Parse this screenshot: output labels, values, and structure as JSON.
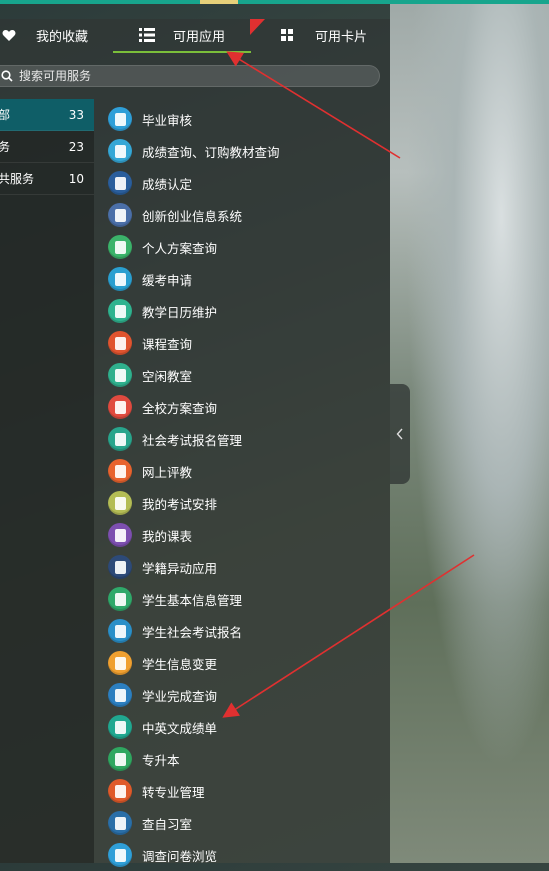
{
  "tabs": [
    {
      "label": "我的收藏",
      "icon": "heart-icon"
    },
    {
      "label": "可用应用",
      "icon": "list-icon",
      "active": true
    },
    {
      "label": "可用卡片",
      "icon": "grid-icon"
    }
  ],
  "search": {
    "placeholder": "搜索可用服务",
    "icon": "search-icon"
  },
  "categories": [
    {
      "label": "部",
      "count": "33",
      "active": true
    },
    {
      "label": "务",
      "count": "23"
    },
    {
      "label": "共服务",
      "count": "10"
    }
  ],
  "apps": [
    {
      "name": "毕业审核",
      "color": "#2f9fd8"
    },
    {
      "name": "成绩查询、订购教材查询",
      "color": "#35a7d6"
    },
    {
      "name": "成绩认定",
      "color": "#2a5e9c"
    },
    {
      "name": "创新创业信息系统",
      "color": "#4b6fa8"
    },
    {
      "name": "个人方案查询",
      "color": "#3bb36a"
    },
    {
      "name": "缓考申请",
      "color": "#2a9fd0"
    },
    {
      "name": "教学日历维护",
      "color": "#2fb38f"
    },
    {
      "name": "课程查询",
      "color": "#e0542f"
    },
    {
      "name": "空闲教室",
      "color": "#2fb08d"
    },
    {
      "name": "全校方案查询",
      "color": "#e04a3f"
    },
    {
      "name": "社会考试报名管理",
      "color": "#28a58c"
    },
    {
      "name": "网上评教",
      "color": "#e8632e"
    },
    {
      "name": "我的考试安排",
      "color": "#b4bd55"
    },
    {
      "name": "我的课表",
      "color": "#7d4fb0"
    },
    {
      "name": "学籍异动应用",
      "color": "#2d4a78"
    },
    {
      "name": "学生基本信息管理",
      "color": "#2fa96a"
    },
    {
      "name": "学生社会考试报名",
      "color": "#2a8fc8"
    },
    {
      "name": "学生信息变更",
      "color": "#f0a030"
    },
    {
      "name": "学业完成查询",
      "color": "#2c7fc0"
    },
    {
      "name": "中英文成绩单",
      "color": "#20a890"
    },
    {
      "name": "专升本",
      "color": "#2fa760"
    },
    {
      "name": "转专业管理",
      "color": "#e05a2a"
    },
    {
      "name": "查自习室",
      "color": "#2a6fa8"
    },
    {
      "name": "调查问卷浏览",
      "color": "#2f9fd8"
    }
  ],
  "colors": {
    "accent": "#17a58d",
    "tab_underline": "#7bbf3a",
    "active_category": "#0f5e67",
    "annotation_arrow": "#e03030"
  }
}
